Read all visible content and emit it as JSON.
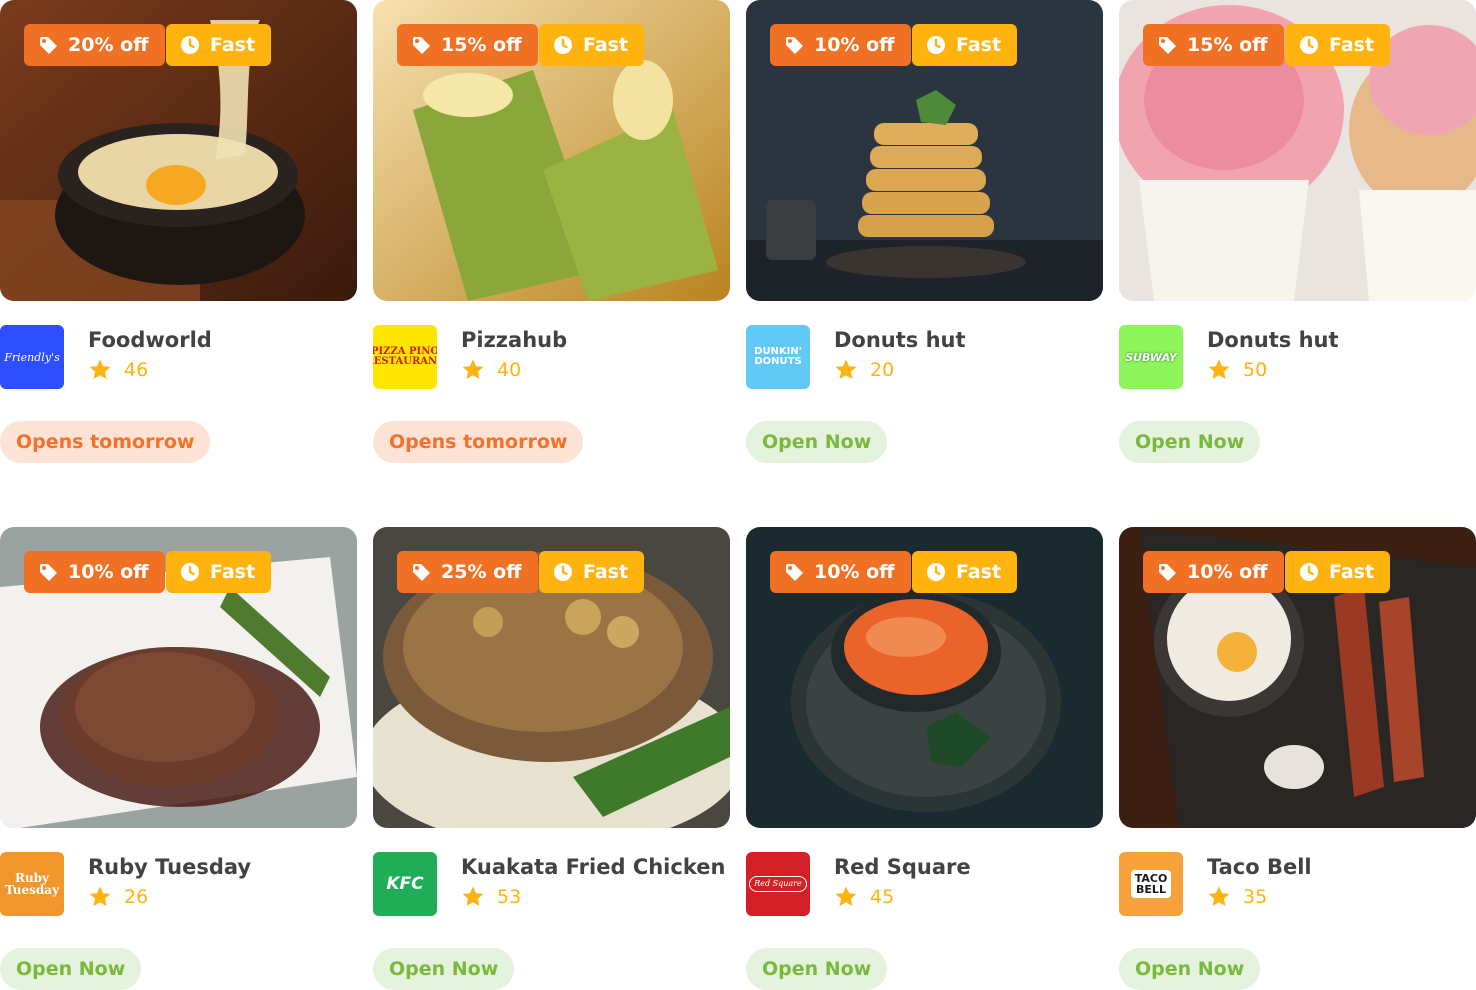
{
  "colors": {
    "discount_badge": "#f07124",
    "fast_badge": "#ffb30e",
    "rating_star": "#ffb30e",
    "opens_tomorrow_bg": "#fde3d6",
    "opens_tomorrow_text": "#f17228",
    "open_now_bg": "#e5f2dd",
    "open_now_text": "#79b93c"
  },
  "icons": {
    "discount": "tag-icon",
    "delivery_speed": "clock-icon",
    "rating": "star-icon"
  },
  "restaurants": [
    {
      "image": "food-photo-cheese-bowl",
      "discount": "20% off",
      "speed": "Fast",
      "logo_text": "Friendly's",
      "logo_bg": "#2e4fff",
      "name": "Foodworld",
      "rating": "46",
      "status": "Opens tomorrow",
      "status_type": "closed"
    },
    {
      "image": "food-photo-green-drinks",
      "discount": "15% off",
      "speed": "Fast",
      "logo_text": "PIZZA PINO RESTAURANT",
      "logo_bg": "#ffe600",
      "name": "Pizzahub",
      "rating": "40",
      "status": "Opens tomorrow",
      "status_type": "closed"
    },
    {
      "image": "food-photo-pancake-stack",
      "discount": "10% off",
      "speed": "Fast",
      "logo_text": "DUNKIN' DONUTS",
      "logo_bg": "#62c8f5",
      "name": "Donuts hut",
      "rating": "20",
      "status": "Open Now",
      "status_type": "open"
    },
    {
      "image": "food-photo-cupcakes",
      "discount": "15% off",
      "speed": "Fast",
      "logo_text": "SUBWAY",
      "logo_bg": "#8ef55a",
      "name": "Donuts hut",
      "rating": "50",
      "status": "Open Now",
      "status_type": "open"
    },
    {
      "image": "food-photo-steak",
      "discount": "10% off",
      "speed": "Fast",
      "logo_text": "Ruby Tuesday",
      "logo_bg": "#f0962a",
      "name": "Ruby Tuesday",
      "rating": "26",
      "status": "Open Now",
      "status_type": "open"
    },
    {
      "image": "food-photo-grilled-chop",
      "discount": "25% off",
      "speed": "Fast",
      "logo_text": "KFC",
      "logo_bg": "#1fae57",
      "name": "Kuakata Fried Chicken",
      "rating": "53",
      "status": "Open Now",
      "status_type": "open"
    },
    {
      "image": "food-photo-curry-soup",
      "discount": "10% off",
      "speed": "Fast",
      "logo_text": "Red Square",
      "logo_bg": "#d51f26",
      "name": "Red Square",
      "rating": "45",
      "status": "Open Now",
      "status_type": "open"
    },
    {
      "image": "food-photo-egg-bacon",
      "discount": "10% off",
      "speed": "Fast",
      "logo_text": "TACO BELL",
      "logo_bg": "#f6a13a",
      "name": "Taco Bell",
      "rating": "35",
      "status": "Open Now",
      "status_type": "open"
    }
  ]
}
